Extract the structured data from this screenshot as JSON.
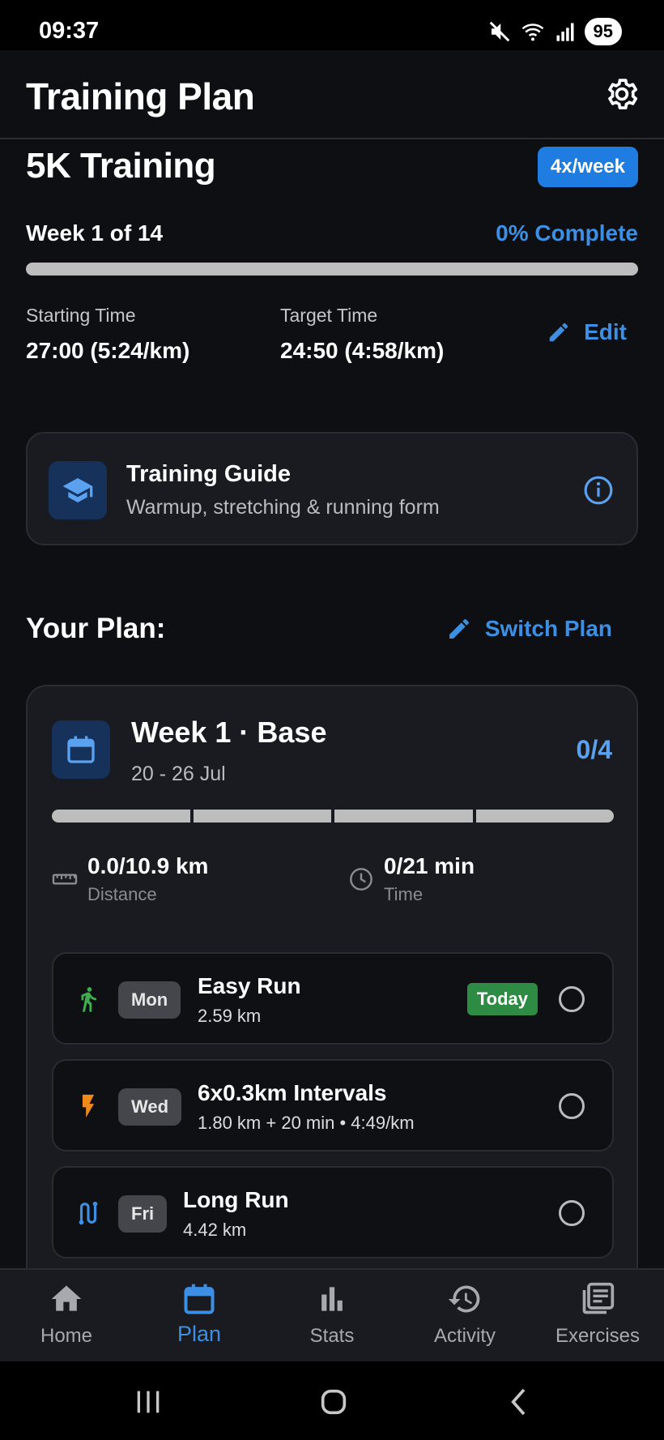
{
  "status_bar": {
    "time": "09:37",
    "battery": "95"
  },
  "header": {
    "title": "Training Plan"
  },
  "program": {
    "title": "5K Training",
    "frequency": "4x/week",
    "week_progress": "Week 1 of 14",
    "complete": "0% Complete",
    "overall_progress_fraction": 0,
    "starting_label": "Starting Time",
    "starting_value": "27:00 (5:24/km)",
    "target_label": "Target Time",
    "target_value": "24:50 (4:58/km)",
    "edit_label": "Edit"
  },
  "guide": {
    "title": "Training Guide",
    "subtitle": "Warmup, stretching & running form"
  },
  "plan": {
    "heading": "Your Plan:",
    "switch_label": "Switch Plan"
  },
  "week": {
    "title": "Week 1 · Base",
    "dates": "20 - 26 Jul",
    "count": "0/4",
    "segments_done": 0,
    "segments_total": 4,
    "distance_value": "0.0/10.9 km",
    "distance_label": "Distance",
    "time_value": "0/21 min",
    "time_label": "Time",
    "workouts": [
      {
        "icon": "walk-icon",
        "day": "Mon",
        "name": "Easy Run",
        "detail": "2.59 km",
        "badge": "Today",
        "icon_color": "#3fae4f"
      },
      {
        "icon": "bolt-icon",
        "day": "Wed",
        "name": "6x0.3km Intervals",
        "detail": "1.80 km + 20 min • 4:49/km",
        "icon_color": "#f08a1c"
      },
      {
        "icon": "route-icon",
        "day": "Fri",
        "name": "Long Run",
        "detail": "4.42 km",
        "icon_color": "#3d8fe4"
      }
    ]
  },
  "bottom_nav": {
    "active": "Plan",
    "items": [
      {
        "label": "Home",
        "icon": "home-icon"
      },
      {
        "label": "Plan",
        "icon": "calendar-icon"
      },
      {
        "label": "Stats",
        "icon": "bar-chart-icon"
      },
      {
        "label": "Activity",
        "icon": "history-icon"
      },
      {
        "label": "Exercises",
        "icon": "library-icon"
      }
    ]
  },
  "colors": {
    "accent": "#3d8fe4",
    "background": "#0e0f13",
    "card": "#1a1b20",
    "today": "#2e8b43"
  }
}
